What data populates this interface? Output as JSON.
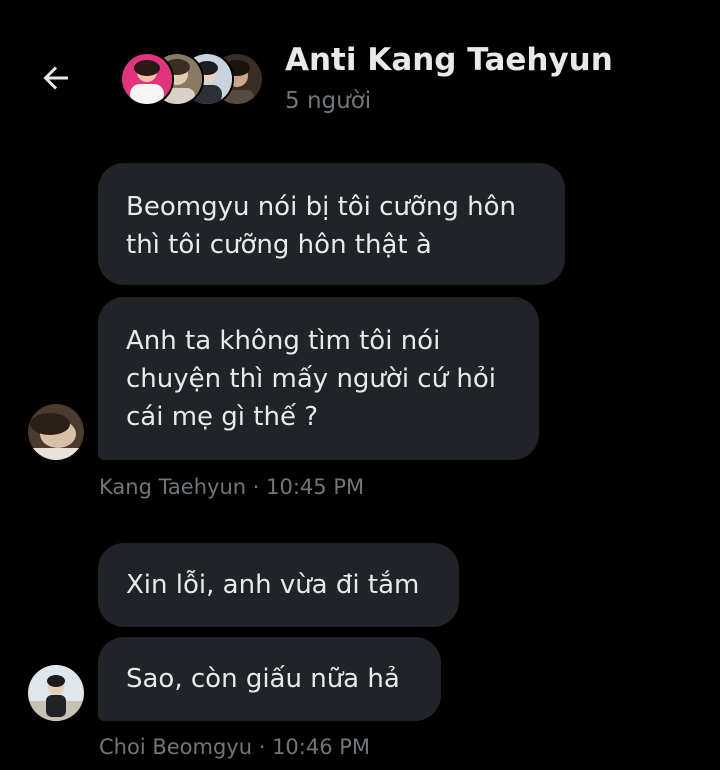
{
  "header": {
    "title": "Anti Kang Taehyun",
    "member_count": "5 người",
    "back_icon": "back-arrow-icon"
  },
  "messages": [
    {
      "lines": [
        "Beomgyu nói bị tôi cưỡng hôn",
        "thì tôi cưỡng hôn thật à"
      ]
    },
    {
      "lines": [
        "Anh ta không tìm tôi nói",
        "chuyện thì mấy người cứ hỏi",
        "cái mẹ gì thế ?"
      ]
    },
    {
      "lines": [
        "Xin lỗi, anh vừa đi tắm"
      ]
    },
    {
      "lines": [
        "Sao, còn giấu nữa hả"
      ]
    }
  ],
  "groups": [
    {
      "sender": "Kang Taehyun",
      "separator": " · ",
      "time": "10:45 PM"
    },
    {
      "sender": "Choi Beomgyu",
      "separator": " · ",
      "time": "10:46 PM"
    }
  ],
  "colors": {
    "background": "#000000",
    "bubble": "#202327",
    "text": "#e7e9ea",
    "muted": "#71767b"
  }
}
